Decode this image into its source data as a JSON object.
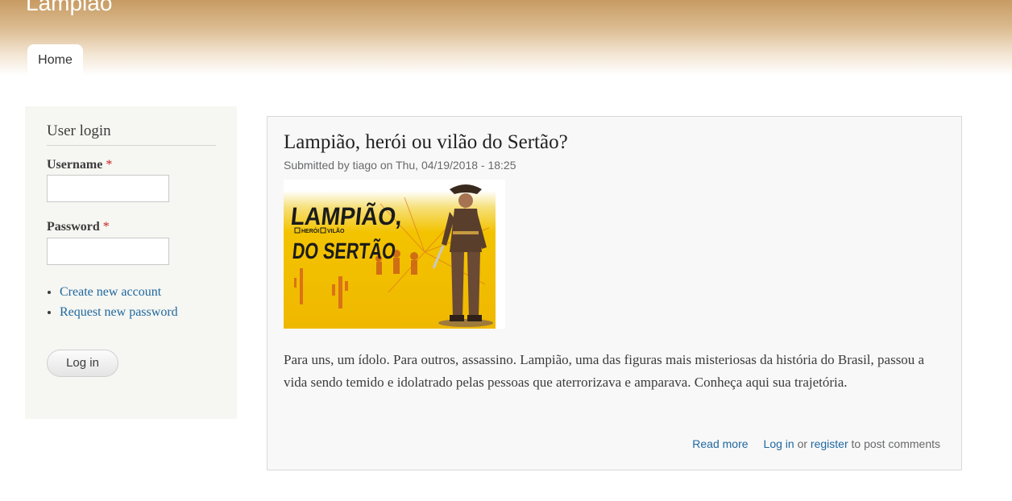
{
  "site": {
    "name": "Lampião"
  },
  "nav": {
    "tabs": [
      {
        "label": "Home"
      }
    ]
  },
  "login_block": {
    "title": "User login",
    "username_label": "Username",
    "password_label": "Password",
    "required_marker": "*",
    "username_value": "",
    "password_value": "",
    "links": [
      "Create new account",
      "Request new password"
    ],
    "submit_label": "Log in"
  },
  "article": {
    "title": "Lampião, herói ou vilão do Sertão?",
    "submitted": "Submitted by tiago on Thu, 04/19/2018 - 18:25",
    "image": {
      "line1": "LAMPIÃO,",
      "check1": "HERÓI",
      "check2": "VILÃO",
      "line2": "DO SERTÃO"
    },
    "body": "Para uns, um ídolo. Para outros, assassino. Lampião, uma das figuras mais misteriosas da história do Brasil, passou a vida sendo temido e idolatrado pelas pessoas que aterrorizava e amparava. Conheça aqui sua trajetória.",
    "read_more": "Read more",
    "login_link": "Log in",
    "or_text": "or",
    "register_link": "register",
    "post_comments_text": "to post comments"
  },
  "colors": {
    "link": "#1f68a0",
    "header_top": "#c79b62",
    "sidebar_bg": "#f6f6f2",
    "required": "#cc1f1f",
    "image_yellow": "#f3c300"
  }
}
